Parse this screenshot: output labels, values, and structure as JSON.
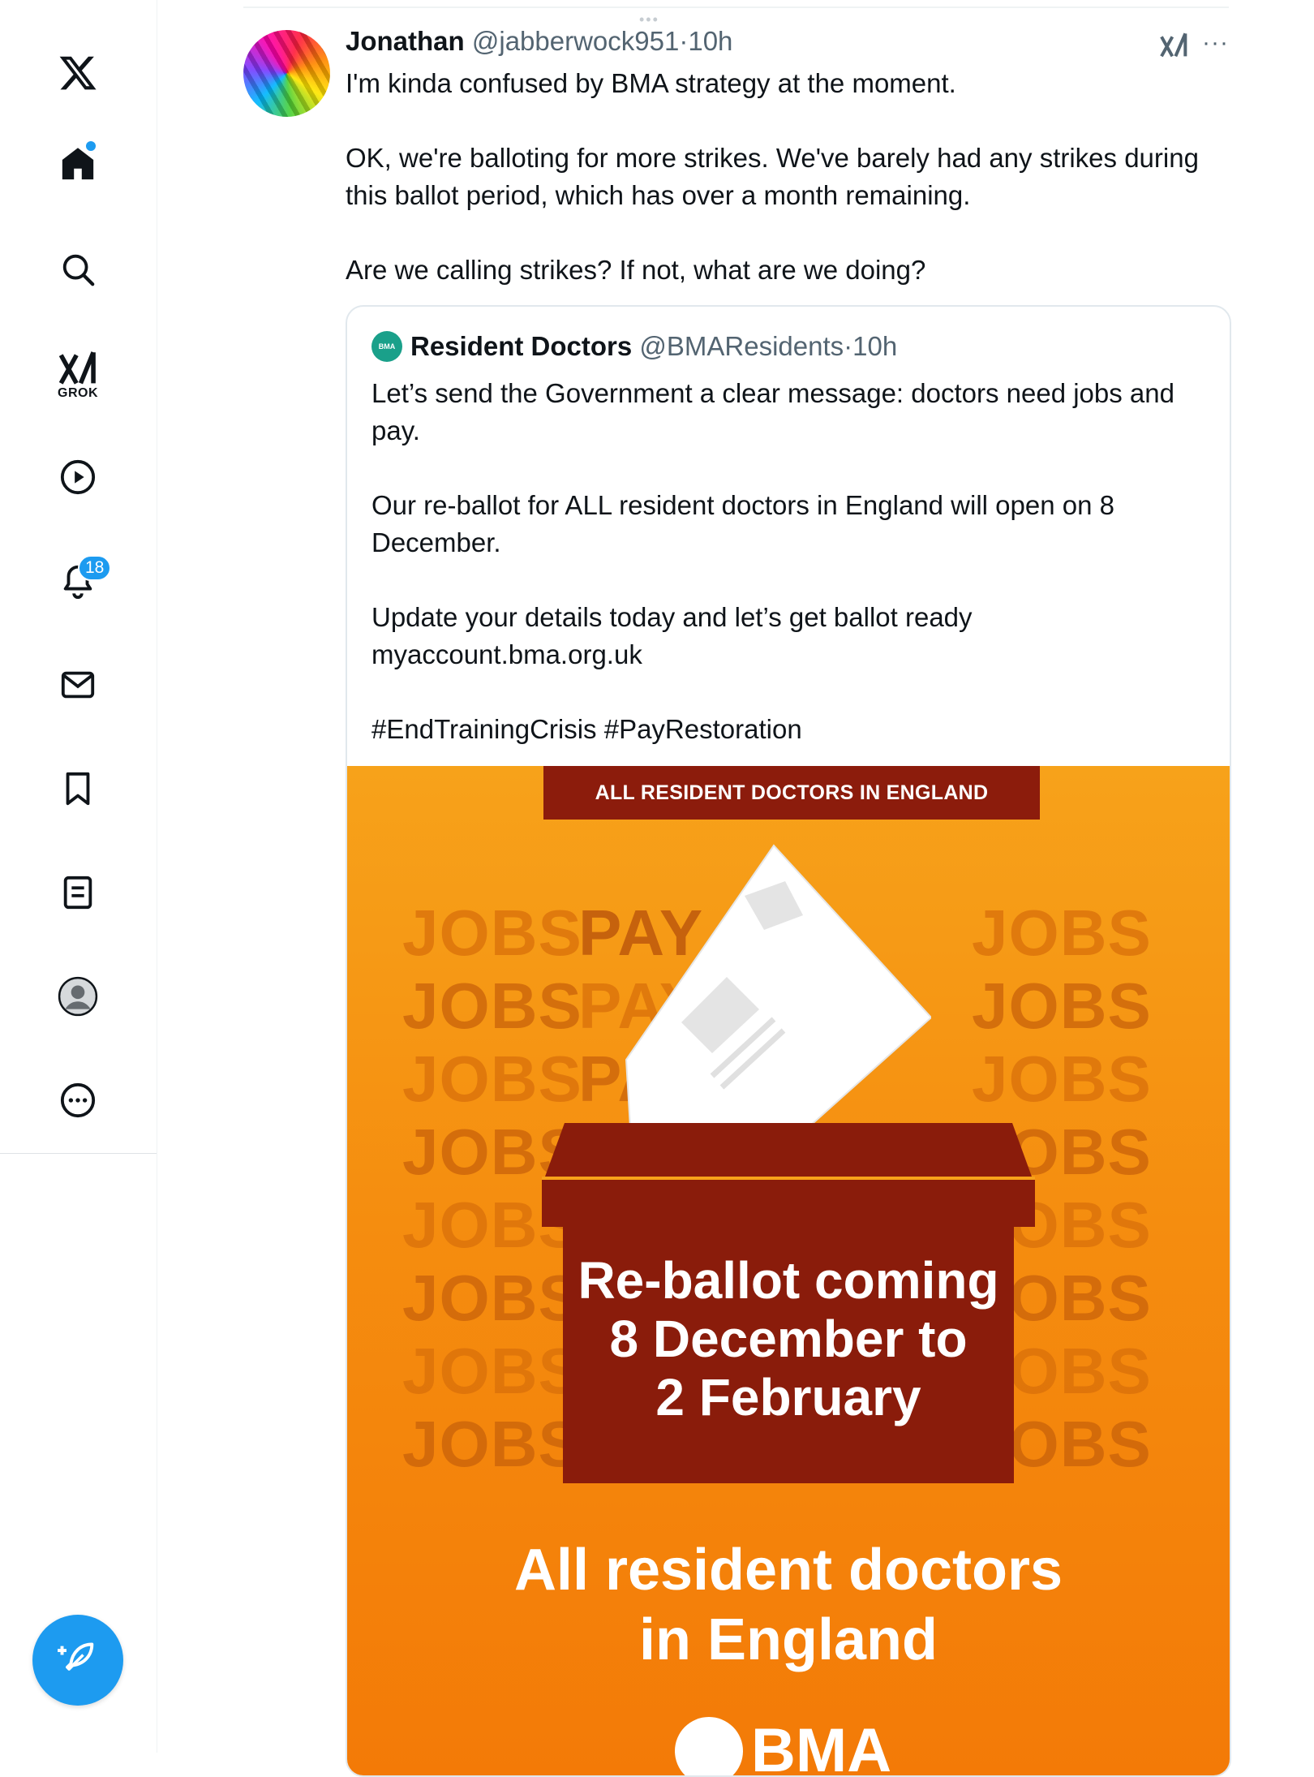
{
  "sidebar": {
    "items": [
      {
        "name": "x-logo-icon"
      },
      {
        "name": "home-icon"
      },
      {
        "name": "search-icon"
      },
      {
        "name": "grok-icon",
        "label": "GROK"
      },
      {
        "name": "video-icon"
      },
      {
        "name": "notifications-icon",
        "badge": "18"
      },
      {
        "name": "messages-icon"
      },
      {
        "name": "bookmarks-icon"
      },
      {
        "name": "lists-icon"
      },
      {
        "name": "profile-icon"
      },
      {
        "name": "more-icon"
      }
    ],
    "compose_icon": "compose-feather-icon",
    "accent": "#1d9bf0"
  },
  "post": {
    "author_name": "Jonathan",
    "handle": "@jabberwock951",
    "separator": "·",
    "time": "10h",
    "paragraphs": [
      "I'm kinda confused by BMA strategy at the moment.",
      "OK, we're balloting for more strikes. We've barely had any strikes during this ballot period, which has over a month remaining.",
      "Are we calling strikes? If not, what are we doing?"
    ],
    "more_label": "···"
  },
  "quote": {
    "logo_text": "BMA",
    "author_name": "Resident Doctors",
    "handle": "@BMAResidents",
    "separator": "·",
    "time": "10h",
    "paragraphs": [
      "Let’s send the Government a clear message: doctors need jobs and pay.",
      "Our re-ballot for ALL resident doctors in England will open on 8 December.",
      "Update your details today and let’s get ballot ready myaccount.bma.org.uk",
      "#EndTrainingCrisis #PayRestoration"
    ]
  },
  "poster": {
    "banner": "ALL RESIDENT DOCTORS IN ENGLAND",
    "word_jobs": "JOBS",
    "word_pay": "PAY",
    "box_line1": "Re-ballot coming",
    "box_line2": "8 December to",
    "box_line3": "2 February",
    "footer_line1": "All resident doctors",
    "footer_line2": "in England",
    "logo_text": "BMA",
    "colors": {
      "orange": "#f58d0f",
      "maroon": "#8a1c0b"
    }
  }
}
